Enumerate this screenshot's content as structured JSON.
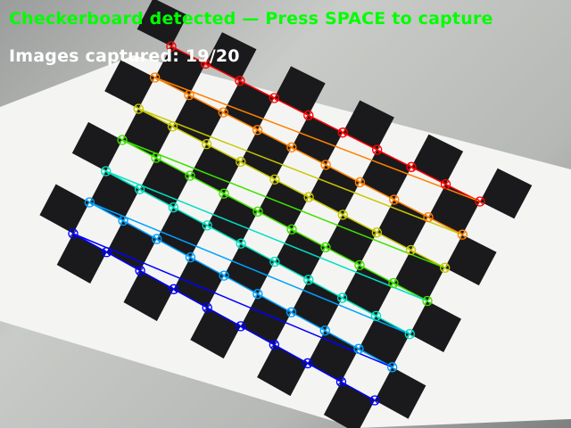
{
  "overlay": {
    "status_text": "Checkerboard detected — Press SPACE to capture",
    "status_color": "#00ff00",
    "captured_label": "Images captured:",
    "captured_count": 19,
    "captured_total": 20,
    "captured_text": "Images captured: 19/20",
    "captured_color": "#ffffff"
  },
  "checkerboard": {
    "detected": true,
    "inner_corners_cols": 10,
    "inner_corners_rows": 7,
    "row_colors": [
      "#ff0000",
      "#ff8000",
      "#c8c800",
      "#40e000",
      "#00e0c0",
      "#00a0ff",
      "#0000ff"
    ],
    "square_color": "#1a1a1c",
    "paper_color": "#f4f5f3"
  }
}
